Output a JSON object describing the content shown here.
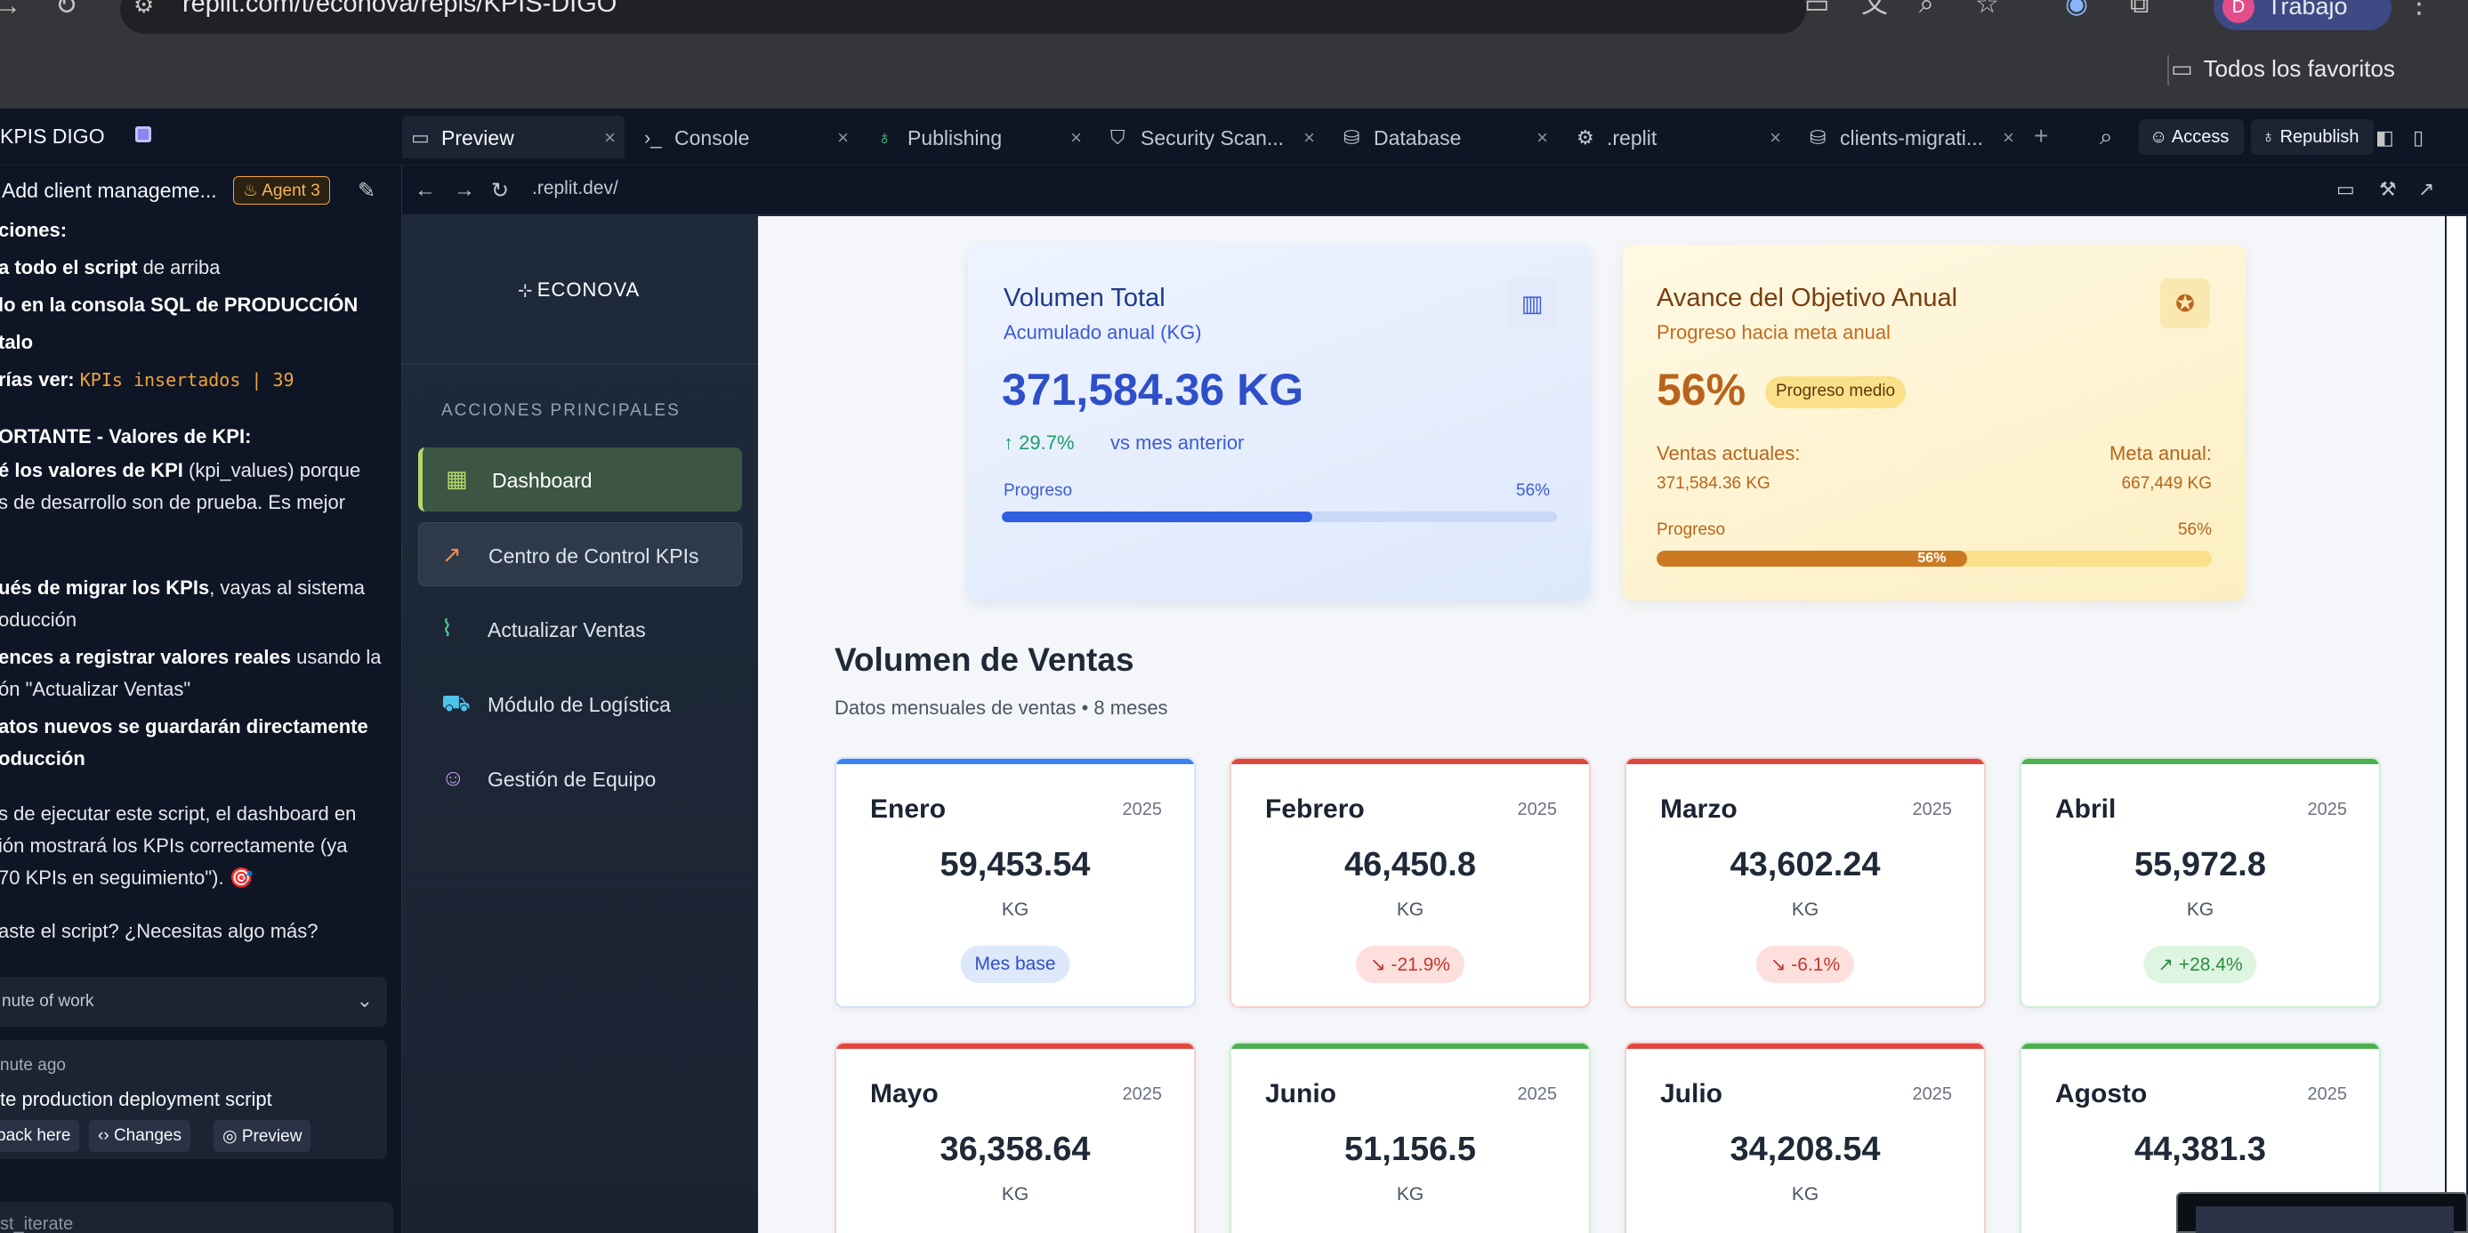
{
  "browser": {
    "url": "replit.com/t/econova/repls/KPIS-DIGO",
    "profile_initial": "D",
    "profile_label": "Trabajo",
    "bookmarks_label": "Todos los favoritos"
  },
  "replit": {
    "project_name": "KPIS DIGO",
    "tabs": [
      {
        "label": "Preview"
      },
      {
        "label": "Console"
      },
      {
        "label": "Publishing"
      },
      {
        "label": "Security Scan..."
      },
      {
        "label": "Database"
      },
      {
        "label": ".replit"
      },
      {
        "label": "clients-migrati..."
      }
    ],
    "access_label": "Access",
    "republish_label": "Republish",
    "preview_path": ".replit.dev/"
  },
  "agent": {
    "title": "Add client manageme...",
    "badge": "Agent 3",
    "lines": [
      {
        "b": "ciones:",
        "t": ""
      },
      {
        "b": "a todo el script",
        "t": " de arriba"
      },
      {
        "b": "lo en la consola SQL de PRODUCCIÓN",
        "t": ""
      },
      {
        "b": "talo",
        "t": ""
      },
      {
        "b": "rías ver:",
        "t": ""
      },
      {
        "b": "ORTANTE - Valores de KPI:",
        "t": ""
      },
      {
        "b": "é los valores de KPI",
        "t": " (kpi_values) porque"
      },
      {
        "b": "",
        "t": "s de desarrollo son de prueba. Es mejor"
      },
      {
        "b": "ués de migrar los KPIs",
        "t": ", vayas al sistema"
      },
      {
        "b": "",
        "t": "oducción"
      },
      {
        "b": "ences a registrar valores reales",
        "t": " usando la"
      },
      {
        "b": "",
        "t": "ón \"Actualizar Ventas\""
      },
      {
        "b": "atos nuevos se guardarán directamente",
        "t": ""
      },
      {
        "b": "oducción",
        "t": ""
      },
      {
        "b": "",
        "t": "s de ejecutar este script, el dashboard en"
      },
      {
        "b": "",
        "t": "ión mostrará los KPIs correctamente (ya"
      },
      {
        "b": "",
        "t": "70 KPIs en seguimiento\"). 🎯"
      },
      {
        "b": "",
        "t": "aste el script? ¿Necesitas algo más?"
      }
    ],
    "code": "KPIs insertados | 39",
    "work_summary": "nute of work",
    "checkpoint_time": "nute ago",
    "checkpoint_msg": "te production deployment script",
    "btn_rollback": "back here",
    "btn_changes": "Changes",
    "btn_preview": "Preview",
    "input_hint": "st_iterate"
  },
  "app": {
    "logo": "ECONOVA",
    "section": "ACCIONES PRINCIPALES",
    "nav": [
      {
        "label": "Dashboard",
        "icon": "grid-icon"
      },
      {
        "label": "Centro de Control KPIs",
        "icon": "trending-up-icon"
      },
      {
        "label": "Actualizar Ventas",
        "icon": "line-chart-icon"
      },
      {
        "label": "Módulo de Logística",
        "icon": "truck-icon"
      },
      {
        "label": "Gestión de Equipo",
        "icon": "users-icon"
      }
    ],
    "volume": {
      "title": "Volumen Total",
      "subtitle": "Acumulado anual (KG)",
      "value": "371,584.36 KG",
      "change": "29.7%",
      "change_label": "vs mes anterior",
      "progress_label": "Progreso",
      "progress_pct": "56%",
      "progress": 0.56
    },
    "goal": {
      "title": "Avance del Objetivo Anual",
      "subtitle": "Progreso hacia meta anual",
      "pct": "56%",
      "badge": "Progreso medio",
      "sales_label": "Ventas actuales:",
      "sales_value": "371,584.36 KG",
      "target_label": "Meta anual:",
      "target_value": "667,449 KG",
      "progress_label": "Progreso",
      "progress_pct": "56%",
      "progress": 0.56
    },
    "sales": {
      "title": "Volumen de Ventas",
      "subtitle": "Datos mensuales de ventas • 8 meses",
      "months": [
        {
          "name": "Enero",
          "year": "2025",
          "value": "59,453.54",
          "unit": "KG",
          "badge": "Mes base",
          "kind": "base"
        },
        {
          "name": "Febrero",
          "year": "2025",
          "value": "46,450.8",
          "unit": "KG",
          "badge": "-21.9%",
          "kind": "down"
        },
        {
          "name": "Marzo",
          "year": "2025",
          "value": "43,602.24",
          "unit": "KG",
          "badge": "-6.1%",
          "kind": "down"
        },
        {
          "name": "Abril",
          "year": "2025",
          "value": "55,972.8",
          "unit": "KG",
          "badge": "+28.4%",
          "kind": "up"
        },
        {
          "name": "Mayo",
          "year": "2025",
          "value": "36,358.64",
          "unit": "KG",
          "badge": "",
          "kind": "down"
        },
        {
          "name": "Junio",
          "year": "2025",
          "value": "51,156.5",
          "unit": "KG",
          "badge": "",
          "kind": "up"
        },
        {
          "name": "Julio",
          "year": "2025",
          "value": "34,208.54",
          "unit": "KG",
          "badge": "",
          "kind": "down"
        },
        {
          "name": "Agosto",
          "year": "2025",
          "value": "44,381.3",
          "unit": "",
          "badge": "",
          "kind": "up"
        }
      ]
    },
    "colors": {
      "accent_blue": "#2f4fc9",
      "accent_orange": "#b8641c",
      "up_green": "#4caf50",
      "down_red": "#e0473e",
      "base_blue": "#3b82f6"
    }
  }
}
